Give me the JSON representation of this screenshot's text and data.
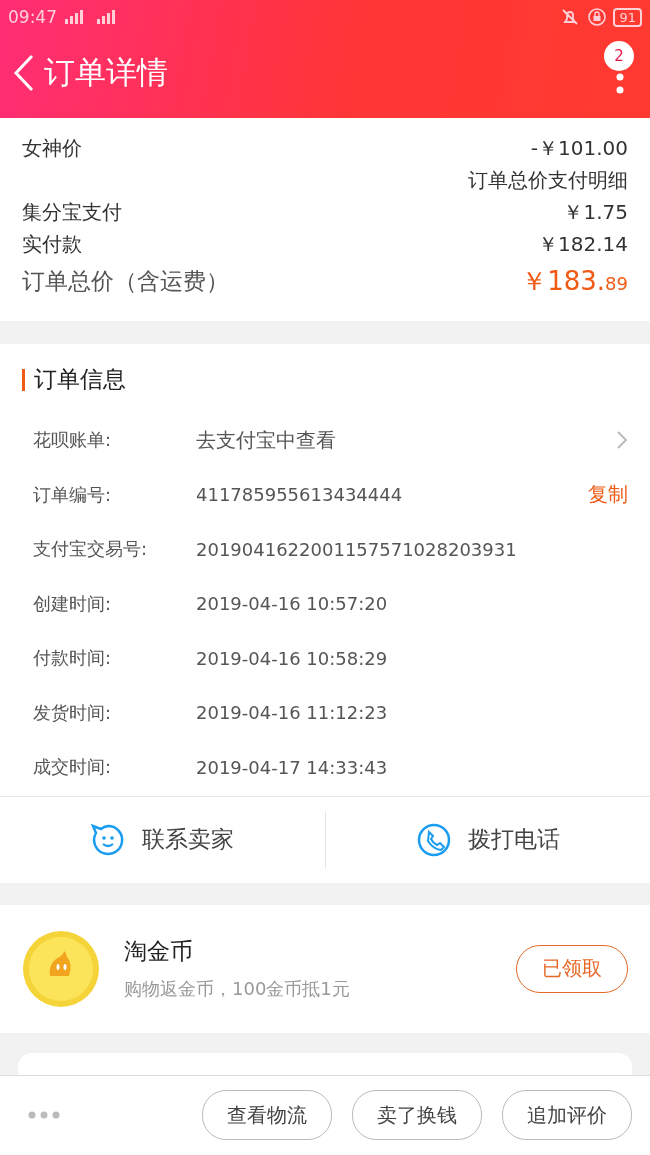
{
  "status_bar": {
    "time": "09:47",
    "battery": "91"
  },
  "header": {
    "title": "订单详情",
    "badge": "2"
  },
  "price_rows": [
    {
      "kind": "row",
      "label": "女神价",
      "value": "-￥101.00"
    },
    {
      "kind": "link",
      "value": "订单总价支付明细"
    },
    {
      "kind": "row",
      "label": "集分宝支付",
      "value": "￥1.75"
    },
    {
      "kind": "row",
      "label": "实付款",
      "value": "￥182.14"
    }
  ],
  "total": {
    "label": "订单总价（含运费）",
    "main": "￥183.",
    "cents": "89"
  },
  "order_info": {
    "title": "订单信息",
    "rows": [
      {
        "kind": "link",
        "label": "花呗账单:",
        "value": "去支付宝中查看"
      },
      {
        "kind": "copy",
        "label": "订单编号:",
        "value": "411785955613434444",
        "action": "复制"
      },
      {
        "kind": "plain",
        "label": "支付宝交易号:",
        "value": "2019041622001157571028203931"
      },
      {
        "kind": "plain",
        "label": "创建时间:",
        "value": "2019-04-16 10:57:20"
      },
      {
        "kind": "plain",
        "label": "付款时间:",
        "value": "2019-04-16 10:58:29"
      },
      {
        "kind": "plain",
        "label": "发货时间:",
        "value": "2019-04-16 11:12:23"
      },
      {
        "kind": "plain",
        "label": "成交时间:",
        "value": "2019-04-17 14:33:43"
      }
    ]
  },
  "contacts": [
    {
      "kind": "chat",
      "label": "联系卖家"
    },
    {
      "kind": "phone",
      "label": "拨打电话"
    }
  ],
  "coins": {
    "title": "淘金币",
    "subtitle": "购物返金币，100金币抵1元",
    "button": "已领取"
  },
  "bottom_bar": {
    "buttons": [
      "查看物流",
      "卖了换钱",
      "追加评价"
    ]
  }
}
